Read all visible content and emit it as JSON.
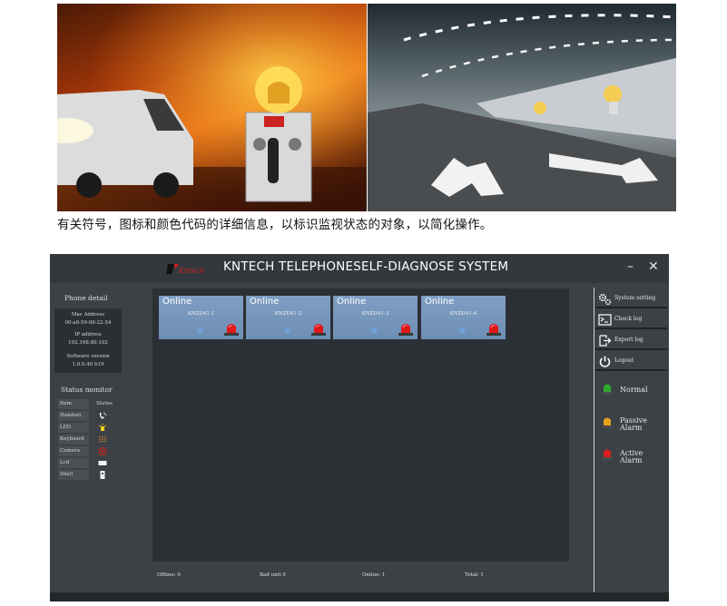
{
  "caption": "有关符号，图标和颜色代码的详细信息，以标识监视状态的对象，以简化操作。",
  "app": {
    "title": "KNTECH TELEPHONESELF-DIAGNOSE SYSTEM",
    "window_controls": {
      "minimize": "–",
      "close": "✕"
    },
    "logo_icon": "kntech-logo-icon"
  },
  "phone_detail": {
    "heading": "Phone detail",
    "mac_label": "Mac Address",
    "mac_value": "00-a8-59-00-22-54",
    "ip_label": "IP address",
    "ip_value": "192.168.80.192",
    "sw_label": "Software version",
    "sw_value": "1.0.0.40 b19"
  },
  "status_monitor": {
    "heading": "Status monitor",
    "col_item": "Item",
    "col_status": "Status",
    "rows": [
      {
        "item": "Handset",
        "icon": "handset-icon"
      },
      {
        "item": "LED",
        "icon": "led-icon"
      },
      {
        "item": "Keyboard",
        "icon": "keyboard-icon"
      },
      {
        "item": "Camera",
        "icon": "camera-icon"
      },
      {
        "item": "Lcd",
        "icon": "lcd-icon"
      },
      {
        "item": "Shell",
        "icon": "shell-icon"
      }
    ]
  },
  "devices": [
    {
      "status": "Online",
      "name": "KNZD41-1"
    },
    {
      "status": "Online",
      "name": "KNZD41-2"
    },
    {
      "status": "Online",
      "name": "KNZD41-3"
    },
    {
      "status": "Online",
      "name": "KNZD41-4"
    }
  ],
  "footer": {
    "offline": "Offline: 0",
    "bad_unit": "Bad unit 0",
    "online": "Online:  1",
    "total": "Total:   1"
  },
  "menu": {
    "system_setting": "System setting",
    "check_log": "Check log",
    "export_log": "Export log",
    "logout": "Logout"
  },
  "legend": {
    "normal": "Normal",
    "passive_1": "Passive",
    "passive_2": "Alarm",
    "active_1": "Active",
    "active_2": "Alarm"
  },
  "colors": {
    "window_bg": "#3c4145",
    "main_bg": "#2b3035",
    "card_bg": "#7f9ec3",
    "normal": "#2fa82f",
    "passive": "#e6a11a",
    "active": "#d81f1f"
  }
}
